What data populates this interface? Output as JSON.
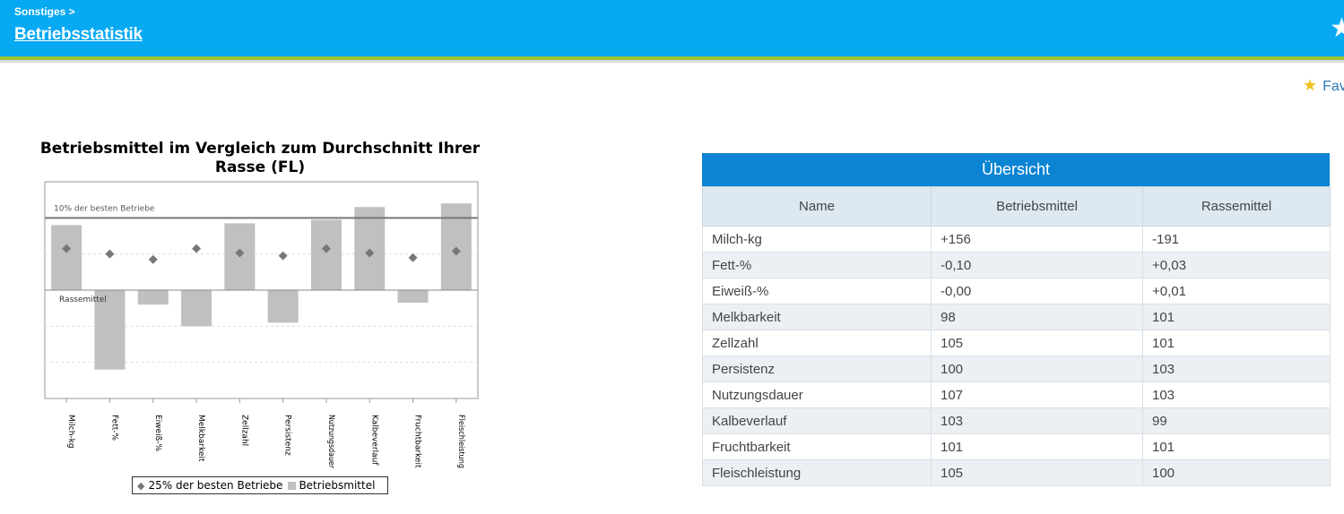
{
  "header": {
    "breadcrumb": "Sonstiges >",
    "title": "Betriebsstatistik",
    "star_icon": "star-icon"
  },
  "favorites": {
    "label": "Fav",
    "icon": "star-icon"
  },
  "chart_data": {
    "type": "bar",
    "title": "Betriebsmittel im Vergleich zum Durchschnitt Ihrer Rasse (FL)",
    "categories": [
      "Milch-kg",
      "Fett-%",
      "Eiweiß-%",
      "Melkbarkeit",
      "Zellzahl",
      "Persistenz",
      "Nutzungsdauer",
      "Kalbeverlauf",
      "Fruchtbarkeit",
      "Fleischleistung"
    ],
    "baseline_label": "Rassemittel",
    "reference_line_label": "10% der besten Betriebe",
    "reference_line_value": 2,
    "ylim": [
      -3,
      3
    ],
    "series": [
      {
        "name": "Betriebsmittel",
        "type": "bar",
        "values": [
          1.8,
          -2.2,
          -0.4,
          -1.0,
          1.85,
          -0.9,
          1.95,
          2.3,
          -0.35,
          2.4
        ]
      },
      {
        "name": "25% der besten Betriebe",
        "type": "marker",
        "values": [
          1.15,
          1.0,
          0.85,
          1.15,
          1.03,
          0.95,
          1.15,
          1.03,
          0.9,
          1.08
        ]
      }
    ],
    "grid": true,
    "legend_position": "bottom"
  },
  "legend": {
    "marker_label": "25% der besten Betriebe",
    "bar_label": "Betriebsmittel"
  },
  "overview": {
    "title": "Übersicht",
    "columns": [
      "Name",
      "Betriebsmittel",
      "Rassemittel"
    ],
    "rows": [
      [
        "Milch-kg",
        "+156",
        "-191"
      ],
      [
        "Fett-%",
        "-0,10",
        "+0,03"
      ],
      [
        "Eiweiß-%",
        "-0,00",
        "+0,01"
      ],
      [
        "Melkbarkeit",
        "98",
        "101"
      ],
      [
        "Zellzahl",
        "105",
        "101"
      ],
      [
        "Persistenz",
        "100",
        "103"
      ],
      [
        "Nutzungsdauer",
        "107",
        "103"
      ],
      [
        "Kalbeverlauf",
        "103",
        "99"
      ],
      [
        "Fruchtbarkeit",
        "101",
        "101"
      ],
      [
        "Fleischleistung",
        "105",
        "100"
      ]
    ]
  },
  "colors": {
    "header": "#07a9f2",
    "header_stripe": "#9bc43c",
    "table_header": "#0a84d3",
    "bar": "#c0c0c0",
    "marker": "#777777"
  }
}
